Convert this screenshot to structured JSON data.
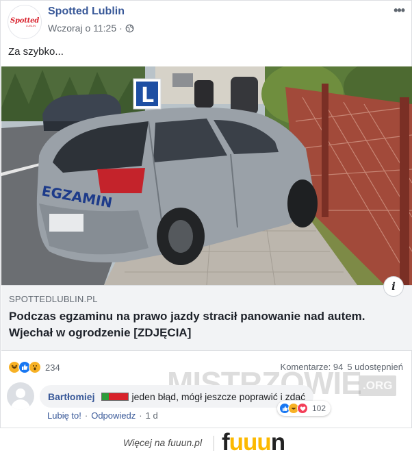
{
  "post": {
    "page_name": "Spotted Lublin",
    "avatar_logo": "Spotted",
    "avatar_sub": "LUBLIN",
    "timestamp": "Wczoraj o 11:25",
    "text": "Za szybko...",
    "more_label": "•••"
  },
  "photo": {
    "l_sign": "L",
    "door_text": "EGZAMIN"
  },
  "link_preview": {
    "domain": "SPOTTEDLUBLIN.PL",
    "headline": "Podczas egzaminu na prawo jazdy stracił panowanie nad autem. Wjechał w ogrodzenie [ZDJĘCIA]",
    "info_glyph": "i"
  },
  "stats": {
    "reaction_count": "234",
    "comments": "Komentarze: 94",
    "shares": "5 udostępnień",
    "reaction_icons": [
      "haha-icon",
      "like-icon",
      "wow-icon"
    ]
  },
  "comment": {
    "author": "Bartłomiej",
    "text": "jeden błąd, mógł jeszcze poprawić i zdać",
    "reaction_count": "102",
    "reaction_icons": [
      "like-icon",
      "haha-icon",
      "love-icon"
    ],
    "like_label": "Lubię to!",
    "reply_label": "Odpowiedz",
    "age": "1 d",
    "separator": "·"
  },
  "watermark": {
    "text": "MISTRZOWIE",
    "org": ".ORG"
  },
  "footer": {
    "more_text": "Więcej na fuuun.pl",
    "logo_f": "f",
    "logo_uuu": "uuu",
    "logo_n": "n"
  },
  "colors": {
    "link_blue": "#385898",
    "reaction_yellow": "#f7b125",
    "like_blue": "#1877f2",
    "love_red": "#f33e58",
    "brand_red": "#d9232e",
    "fuuun_yellow": "#fcb900"
  }
}
